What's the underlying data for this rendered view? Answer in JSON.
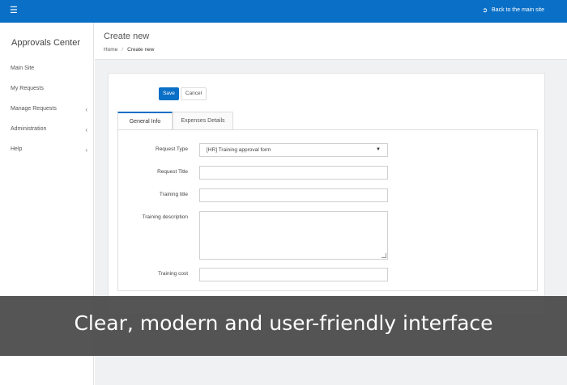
{
  "topbar": {
    "menu_icon": "hamburger-icon",
    "back_icon": "sign-out-icon",
    "back_label": "Back to the main site",
    "accent": "#0a6fc6"
  },
  "sidebar": {
    "brand": "Approvals Center",
    "items": [
      {
        "label": "Main Site",
        "expandable": false
      },
      {
        "label": "My Requests",
        "expandable": false
      },
      {
        "label": "Manage Requests",
        "expandable": true
      },
      {
        "label": "Administration",
        "expandable": true
      },
      {
        "label": "Help",
        "expandable": true
      }
    ],
    "chevron": "‹"
  },
  "header": {
    "title": "Create new",
    "breadcrumb": {
      "home": "Home",
      "separator": "/",
      "current": "Create new"
    }
  },
  "toolbar": {
    "save_label": "Save",
    "cancel_label": "Cancel"
  },
  "tabs": [
    {
      "label": "General Info",
      "active": true
    },
    {
      "label": "Expenses Details",
      "active": false
    }
  ],
  "form": {
    "request_type": {
      "label": "Request Type",
      "value": "[HR] Training approval form"
    },
    "request_title": {
      "label": "Request Title",
      "value": ""
    },
    "training_title": {
      "label": "Training title",
      "value": ""
    },
    "training_description": {
      "label": "Training description",
      "value": ""
    },
    "training_cost": {
      "label": "Training cost",
      "value": ""
    }
  },
  "overlay": {
    "caption": "Clear, modern and user-friendly interface"
  }
}
